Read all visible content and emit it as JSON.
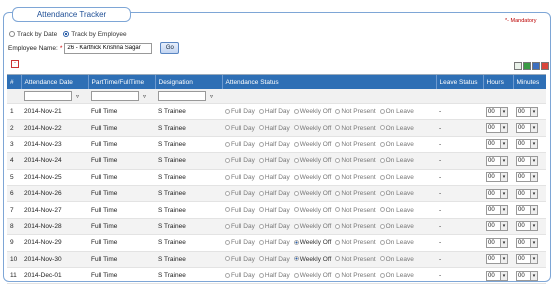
{
  "header": {
    "title": "Attendance Tracker",
    "mandatory": "*- Mandatory"
  },
  "mode": {
    "options": [
      "Track by Date",
      "Track by Employee"
    ],
    "selected": "Track by Employee"
  },
  "employee": {
    "label": "Employee Name:",
    "required_mark": "*",
    "value": "26 - Karthick Krishna Sagar",
    "go_label": "Go"
  },
  "toolbar": {
    "collapse_symbol": "-"
  },
  "grid": {
    "columns": [
      "#",
      "Attendance Date",
      "PartTime/FullTime",
      "Designation",
      "Attendance Status",
      "Leave Status",
      "Hours",
      "Minutes"
    ],
    "status_options": [
      "Full Day",
      "Half Day",
      "Weekly Off",
      "Not Present",
      "On Leave"
    ],
    "rows": [
      {
        "n": "1",
        "date": "2014-Nov-21",
        "type": "Full Time",
        "designation": "S Trainee",
        "status": "",
        "leave": "-",
        "hours": "00",
        "minutes": "00"
      },
      {
        "n": "2",
        "date": "2014-Nov-22",
        "type": "Full Time",
        "designation": "S Trainee",
        "status": "",
        "leave": "-",
        "hours": "00",
        "minutes": "00"
      },
      {
        "n": "3",
        "date": "2014-Nov-23",
        "type": "Full Time",
        "designation": "S Trainee",
        "status": "",
        "leave": "-",
        "hours": "00",
        "minutes": "00"
      },
      {
        "n": "4",
        "date": "2014-Nov-24",
        "type": "Full Time",
        "designation": "S Trainee",
        "status": "",
        "leave": "-",
        "hours": "00",
        "minutes": "00"
      },
      {
        "n": "5",
        "date": "2014-Nov-25",
        "type": "Full Time",
        "designation": "S Trainee",
        "status": "",
        "leave": "-",
        "hours": "00",
        "minutes": "00"
      },
      {
        "n": "6",
        "date": "2014-Nov-26",
        "type": "Full Time",
        "designation": "S Trainee",
        "status": "",
        "leave": "-",
        "hours": "00",
        "minutes": "00"
      },
      {
        "n": "7",
        "date": "2014-Nov-27",
        "type": "Full Time",
        "designation": "S Trainee",
        "status": "",
        "leave": "-",
        "hours": "00",
        "minutes": "00"
      },
      {
        "n": "8",
        "date": "2014-Nov-28",
        "type": "Full Time",
        "designation": "S Trainee",
        "status": "",
        "leave": "-",
        "hours": "00",
        "minutes": "00"
      },
      {
        "n": "9",
        "date": "2014-Nov-29",
        "type": "Full Time",
        "designation": "S Trainee",
        "status": "Weekly Off",
        "leave": "-",
        "hours": "00",
        "minutes": "00"
      },
      {
        "n": "10",
        "date": "2014-Nov-30",
        "type": "Full Time",
        "designation": "S Trainee",
        "status": "Weekly Off",
        "leave": "-",
        "hours": "00",
        "minutes": "00"
      },
      {
        "n": "11",
        "date": "2014-Dec-01",
        "type": "Full Time",
        "designation": "S Trainee",
        "status": "",
        "leave": "-",
        "hours": "00",
        "minutes": "00"
      }
    ]
  }
}
